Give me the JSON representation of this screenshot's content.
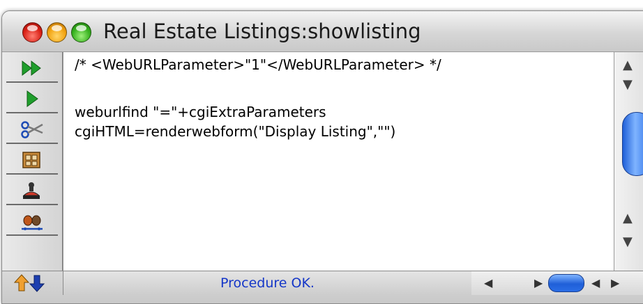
{
  "window": {
    "title": "Real Estate Listings:showlisting"
  },
  "toolbar": {
    "icons": [
      "fast-forward-icon",
      "play-icon",
      "scissors-icon",
      "clipboard-icon",
      "stamp-icon",
      "debug-bugs-icon"
    ]
  },
  "editor": {
    "lines": [
      "/* <WebURLParameter>\"1\"</WebURLParameter> */",
      "",
      "weburlfind \"=\"+cgiExtraParameters",
      "cgiHTML=renderwebform(\"Display Listing\",\"\")"
    ]
  },
  "statusbar": {
    "message": "Procedure OK."
  },
  "colors": {
    "status_text": "#1436c8",
    "toolbar_green": "#1f9e2c",
    "scroll_thumb": "#2b6ee6"
  }
}
